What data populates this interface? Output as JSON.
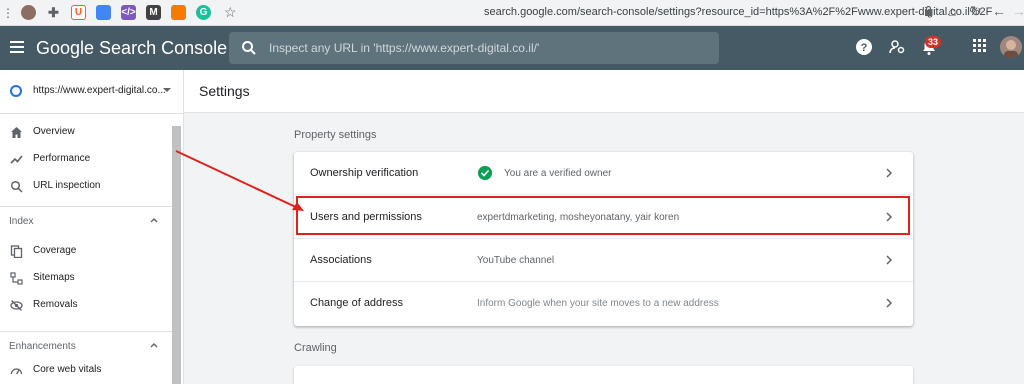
{
  "browser": {
    "url": "search.google.com/search-console/settings?resource_id=https%3A%2F%2Fwww.expert-digital.co.il%2F",
    "extensions": [
      {
        "name": "profile-avatar-icon",
        "color": "#8d6e63",
        "label": ""
      },
      {
        "name": "puzzle-extension-icon",
        "color": "#5f6368",
        "label": ""
      },
      {
        "name": "ubersuggest-extension-icon",
        "color": "#ff5a1f",
        "label": "U"
      },
      {
        "name": "extension-icon-blue",
        "color": "#4285f4",
        "label": ""
      },
      {
        "name": "extension-icon-code",
        "color": "#7e57c2",
        "label": ""
      },
      {
        "name": "extension-icon-m",
        "color": "#424242",
        "label": "M"
      },
      {
        "name": "extension-icon-chart",
        "color": "#f57c00",
        "label": ""
      },
      {
        "name": "grammarly-extension-icon",
        "color": "#15c39a",
        "label": "G"
      }
    ]
  },
  "header": {
    "app_title": "Google Search Console",
    "search_placeholder": "Inspect any URL in 'https://www.expert-digital.co.il/'",
    "notification_count": "33"
  },
  "sidebar": {
    "property": "https://www.expert-digital.co...",
    "items": [
      {
        "label": "Overview",
        "icon": "home-icon"
      },
      {
        "label": "Performance",
        "icon": "trending-up-icon"
      },
      {
        "label": "URL inspection",
        "icon": "search-icon"
      }
    ],
    "index_section": "Index",
    "index_items": [
      {
        "label": "Coverage",
        "icon": "copy-icon"
      },
      {
        "label": "Sitemaps",
        "icon": "sitemap-icon"
      },
      {
        "label": "Removals",
        "icon": "visibility-off-icon"
      }
    ],
    "enhancements_section": "Enhancements",
    "enhancement_items": [
      {
        "label": "Core web vitals",
        "icon": "speed-icon"
      }
    ]
  },
  "main": {
    "title": "Settings",
    "property_settings_label": "Property settings",
    "rows": [
      {
        "label": "Ownership verification",
        "value": "You are a verified owner"
      },
      {
        "label": "Users and permissions",
        "value": "expertdmarketing, mosheyonatany, yair koren"
      },
      {
        "label": "Associations",
        "value": "YouTube channel"
      },
      {
        "label": "Change of address",
        "value": "Inform Google when your site moves to a new address"
      }
    ],
    "crawling_label": "Crawling"
  },
  "colors": {
    "appbar": "#455a64",
    "annotation": "#e0201b",
    "verified": "#0f9d58"
  }
}
